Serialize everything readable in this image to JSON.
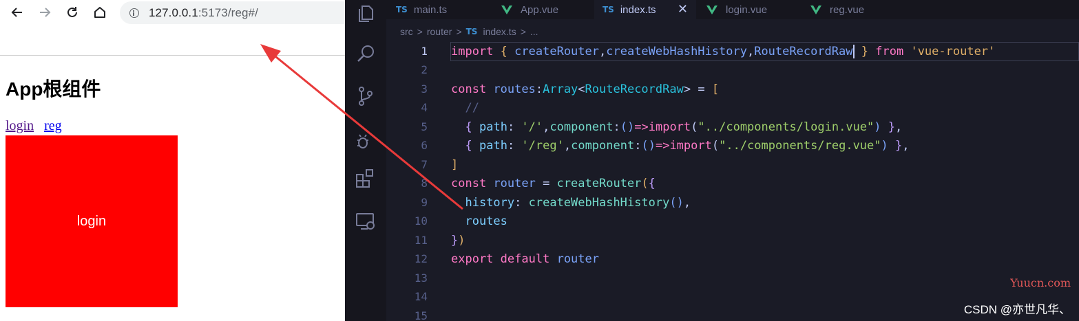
{
  "browser": {
    "url_host": "127.0.0.1",
    "url_rest": ":5173/reg#/",
    "page_title": "App根组件",
    "links": [
      "login",
      "reg"
    ],
    "box_label": "login"
  },
  "editor": {
    "tabs": [
      {
        "badge": "TS",
        "label": "main.ts"
      },
      {
        "badge": "vue",
        "label": "App.vue"
      },
      {
        "badge": "TS",
        "label": "index.ts",
        "close": "✕"
      },
      {
        "badge": "vue",
        "label": "login.vue"
      },
      {
        "badge": "vue",
        "label": "reg.vue"
      }
    ],
    "breadcrumb": [
      "src",
      ">",
      "router",
      ">",
      "TS",
      "index.ts",
      ">",
      "..."
    ],
    "line_numbers": [
      "1",
      "2",
      "3",
      "4",
      "5",
      "6",
      "7",
      "8",
      "9",
      "10",
      "11",
      "12",
      "13",
      "14",
      "15"
    ],
    "code": {
      "l1": [
        "import",
        " ",
        "{",
        " ",
        "createRouter",
        ",",
        "createWebHashHistory",
        ",",
        "RouteRecordRaw",
        " ",
        "}",
        " ",
        "from",
        " ",
        "'vue-router'"
      ],
      "l3": [
        "const",
        " ",
        "routes",
        ":",
        "Array",
        "<",
        "RouteRecordRaw",
        ">",
        " = ",
        "["
      ],
      "l4": [
        "  //"
      ],
      "l5": [
        "  ",
        "{",
        " ",
        "path",
        ": ",
        "'/'",
        ",",
        "component",
        ":",
        "()",
        "=>",
        "import",
        "(",
        "\"../components/login.vue\"",
        ")",
        " ",
        "}",
        ","
      ],
      "l6": [
        "  ",
        "{",
        " ",
        "path",
        ": ",
        "'/reg'",
        ",",
        "component",
        ":",
        "()",
        "=>",
        "import",
        "(",
        "\"../components/reg.vue\"",
        ")",
        " ",
        "}",
        ","
      ],
      "l7": [
        "]"
      ],
      "l8": [
        "const",
        " ",
        "router",
        " = ",
        "createRouter",
        "(",
        "{"
      ],
      "l9": [
        "  ",
        "history",
        ": ",
        "createWebHashHistory",
        "()",
        ","
      ],
      "l10": [
        "  ",
        "routes"
      ],
      "l11": [
        "}",
        ")"
      ],
      "l12": [
        "export",
        " ",
        "default",
        " ",
        "router"
      ]
    },
    "watermark_site": "Yuucn.com",
    "watermark_author": "CSDN @亦世凡华、"
  },
  "colors": {
    "annotation_arrow": "#e83a3a",
    "login_box": "#ff0000"
  },
  "icons": {
    "back": "arrow-left-icon",
    "forward": "arrow-right-icon",
    "reload": "reload-icon",
    "home": "home-icon",
    "site_info": "info-icon",
    "explorer": "files-icon",
    "search": "search-icon",
    "source_control": "source-control-icon",
    "debug": "debug-icon",
    "extensions": "extensions-icon",
    "remote": "remote-explorer-icon"
  }
}
